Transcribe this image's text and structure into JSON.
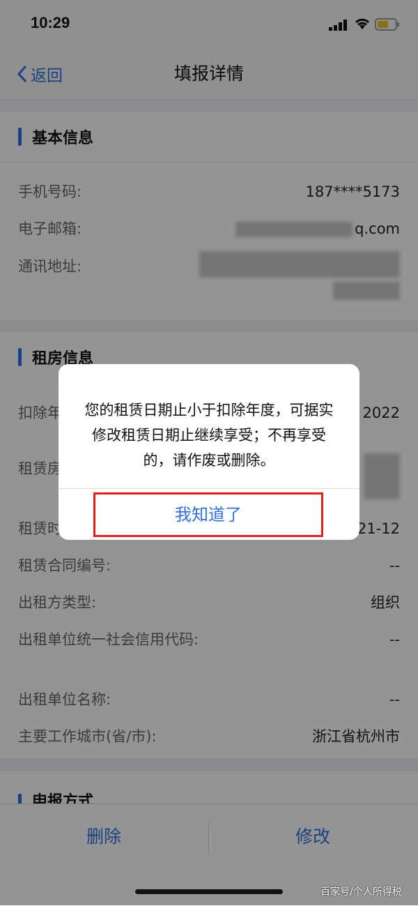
{
  "status_bar": {
    "time": "10:29"
  },
  "nav": {
    "back_label": "返回",
    "title": "填报详情"
  },
  "basic_info": {
    "title": "基本信息",
    "rows": [
      {
        "label": "手机号码:",
        "value": "187****5173"
      },
      {
        "label": "电子邮箱:",
        "value": "q.com"
      },
      {
        "label": "通讯地址:",
        "value": ""
      }
    ]
  },
  "rental_info": {
    "title": "租房信息",
    "rows": [
      {
        "label": "扣除年度:",
        "value": "2022"
      },
      {
        "label": "租赁房屋坐落地址:",
        "value": ""
      },
      {
        "label": "租赁时间:",
        "value": "21-12"
      },
      {
        "label": "租赁合同编号:",
        "value": "--"
      },
      {
        "label": "出租方类型:",
        "value": "组织"
      },
      {
        "label": "出租单位统一社会信用代码:",
        "value": "--"
      },
      {
        "label": "出租单位名称:",
        "value": "--"
      },
      {
        "label": "主要工作城市(省/市):",
        "value": "浙江省杭州市"
      }
    ]
  },
  "report_method": {
    "title": "申报方式"
  },
  "bottom": {
    "delete_label": "删除",
    "edit_label": "修改"
  },
  "dialog": {
    "message": "您的租赁日期止小于扣除年度，可据实修改租赁日期止继续享受；不再享受的，请作废或删除。",
    "confirm_label": "我知道了"
  },
  "watermark": "百家号/个人所得税",
  "colors": {
    "accent": "#2f6fe0",
    "highlight_box": "#e0201b"
  }
}
